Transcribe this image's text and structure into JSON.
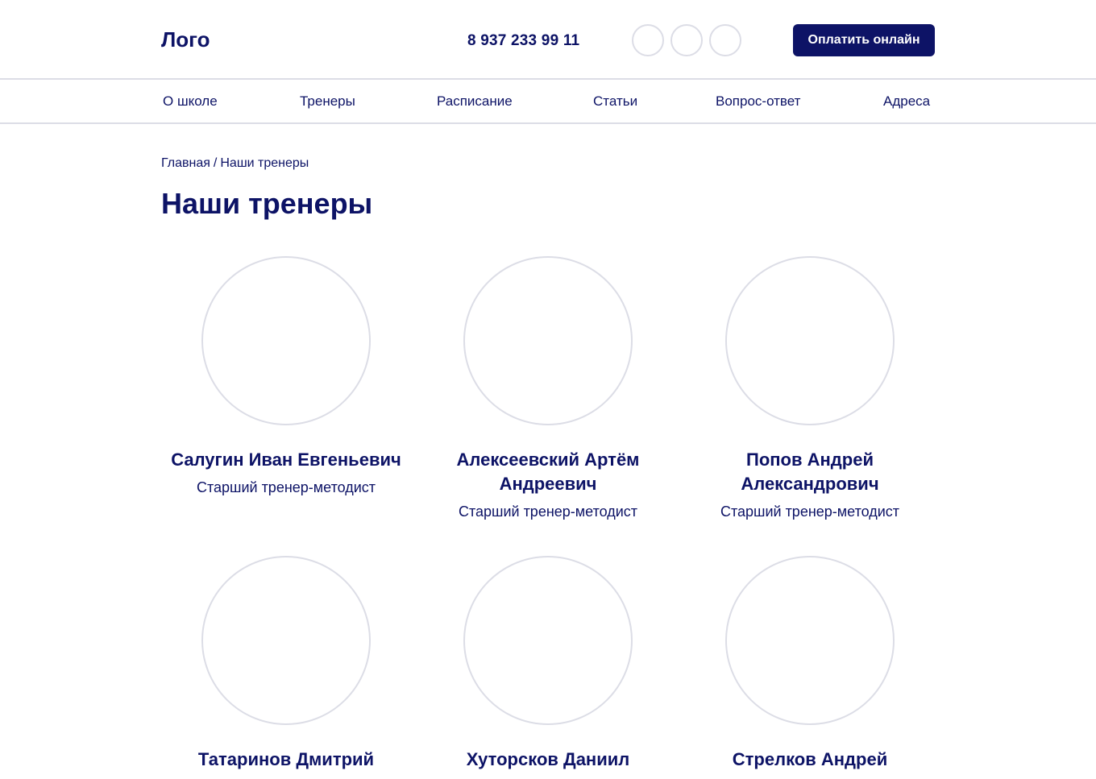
{
  "header": {
    "logo": "Лого",
    "phone": "8 937 233 99 11",
    "social_icons": [
      "social-icon-1",
      "social-icon-2",
      "social-icon-3"
    ],
    "pay_button": "Оплатить онлайн"
  },
  "nav": {
    "items": [
      "О школе",
      "Тренеры",
      "Расписание",
      "Статьи",
      "Вопрос-ответ",
      "Адреса"
    ]
  },
  "breadcrumb": {
    "home": "Главная",
    "separator": "/",
    "current": "Наши тренеры"
  },
  "page": {
    "title": "Наши тренеры"
  },
  "trainers": [
    {
      "name": "Салугин Иван Евгеньевич",
      "role": "Старший тренер-методист"
    },
    {
      "name": "Алексеевский Артём Андреевич",
      "role": "Старший тренер-методист"
    },
    {
      "name": "Попов Андрей Александрович",
      "role": "Старший тренер-методист"
    },
    {
      "name": "Татаринов Дмитрий",
      "role": ""
    },
    {
      "name": "Хуторсков Даниил",
      "role": ""
    },
    {
      "name": "Стрелков Андрей",
      "role": ""
    }
  ],
  "colors": {
    "primary": "#0d1366",
    "border": "#dcdde6",
    "background": "#ffffff"
  }
}
